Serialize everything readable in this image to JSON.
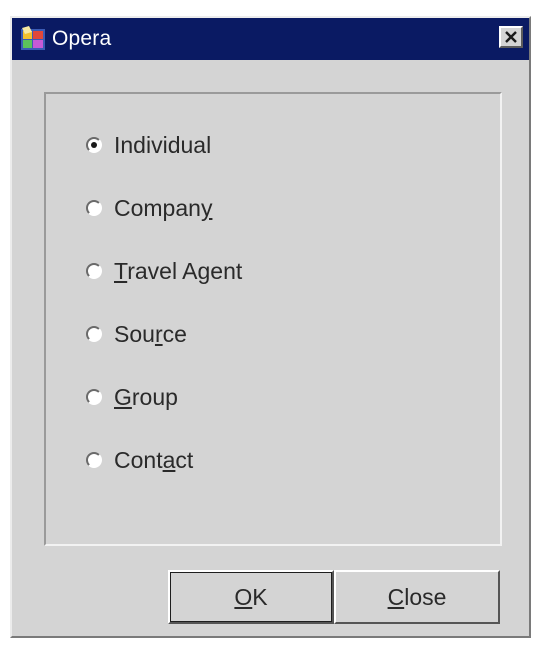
{
  "window": {
    "title": "Opera",
    "icon": "opera-app-icon",
    "close_icon": "close-icon"
  },
  "options": [
    {
      "label": "Individual",
      "selected": true,
      "mnemonic_index": -1
    },
    {
      "label": "Company",
      "selected": false,
      "mnemonic_index": 6
    },
    {
      "label": "Travel Agent",
      "selected": false,
      "mnemonic_index": 0
    },
    {
      "label": "Source",
      "selected": false,
      "mnemonic_index": 3
    },
    {
      "label": "Group",
      "selected": false,
      "mnemonic_index": 0
    },
    {
      "label": "Contact",
      "selected": false,
      "mnemonic_index": 4
    }
  ],
  "buttons": {
    "ok_label": "OK",
    "ok_mnemonic_index": 0,
    "close_label": "Close",
    "close_mnemonic_index": 0
  },
  "colors": {
    "titlebar": "#0a1a63",
    "dialog_bg": "#d4d4d4"
  }
}
